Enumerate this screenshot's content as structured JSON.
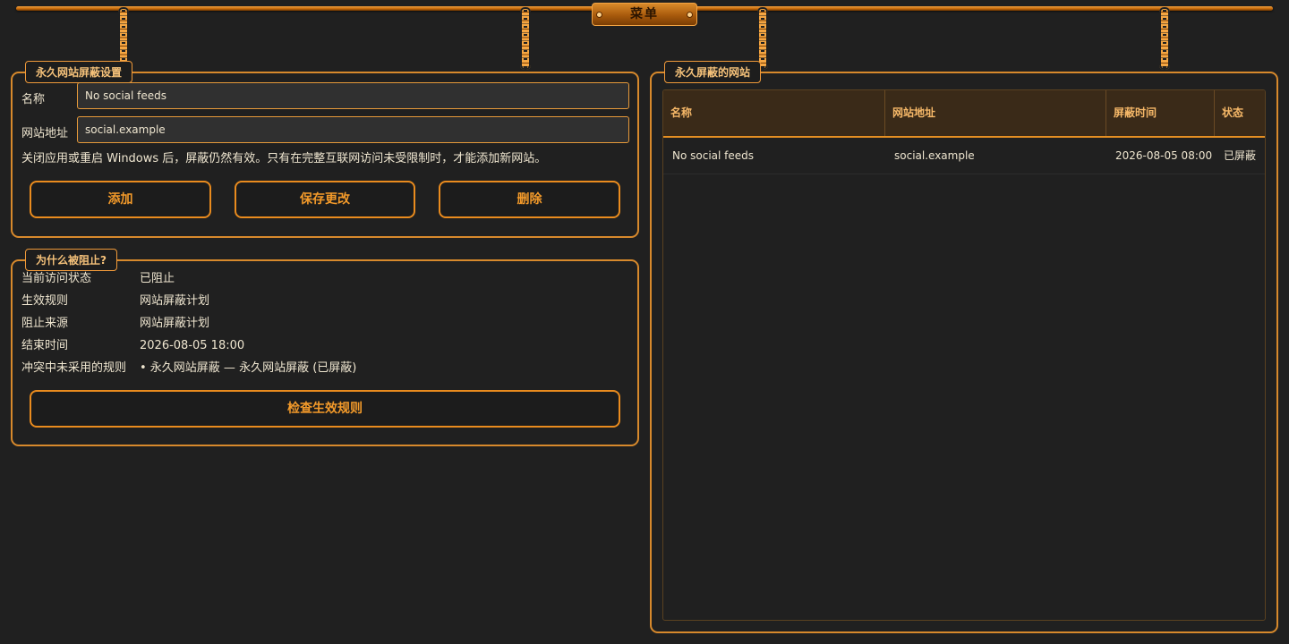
{
  "menu": {
    "label": "菜单"
  },
  "settings": {
    "title": "永久网站屏蔽设置",
    "name_label": "名称",
    "name_value": "No social feeds",
    "url_label": "网站地址",
    "url_value": "social.example",
    "hint": "关闭应用或重启 Windows 后，屏蔽仍然有效。只有在完整互联网访问未受限制时，才能添加新网站。",
    "buttons": {
      "add": "添加",
      "save": "保存更改",
      "delete": "删除"
    }
  },
  "why": {
    "title": "为什么被阻止?",
    "rows": [
      {
        "key": "当前访问状态",
        "value": "已阻止"
      },
      {
        "key": "生效规则",
        "value": "网站屏蔽计划"
      },
      {
        "key": "阻止来源",
        "value": "网站屏蔽计划"
      },
      {
        "key": "结束时间",
        "value": "2026-08-05 18:00"
      },
      {
        "key": "冲突中未采用的规则",
        "value": "• 永久网站屏蔽 — 永久网站屏蔽 (已屏蔽)"
      }
    ],
    "check_button": "检查生效规则"
  },
  "blocked": {
    "title": "永久屏蔽的网站",
    "columns": [
      "名称",
      "网站地址",
      "屏蔽时间",
      "状态"
    ],
    "rows": [
      [
        "No social feeds",
        "social.example",
        "2026-08-05 08:00",
        "已屏蔽"
      ]
    ]
  },
  "colors": {
    "accent": "#e98b1e",
    "background": "#202020",
    "text": "#efe6d0"
  }
}
